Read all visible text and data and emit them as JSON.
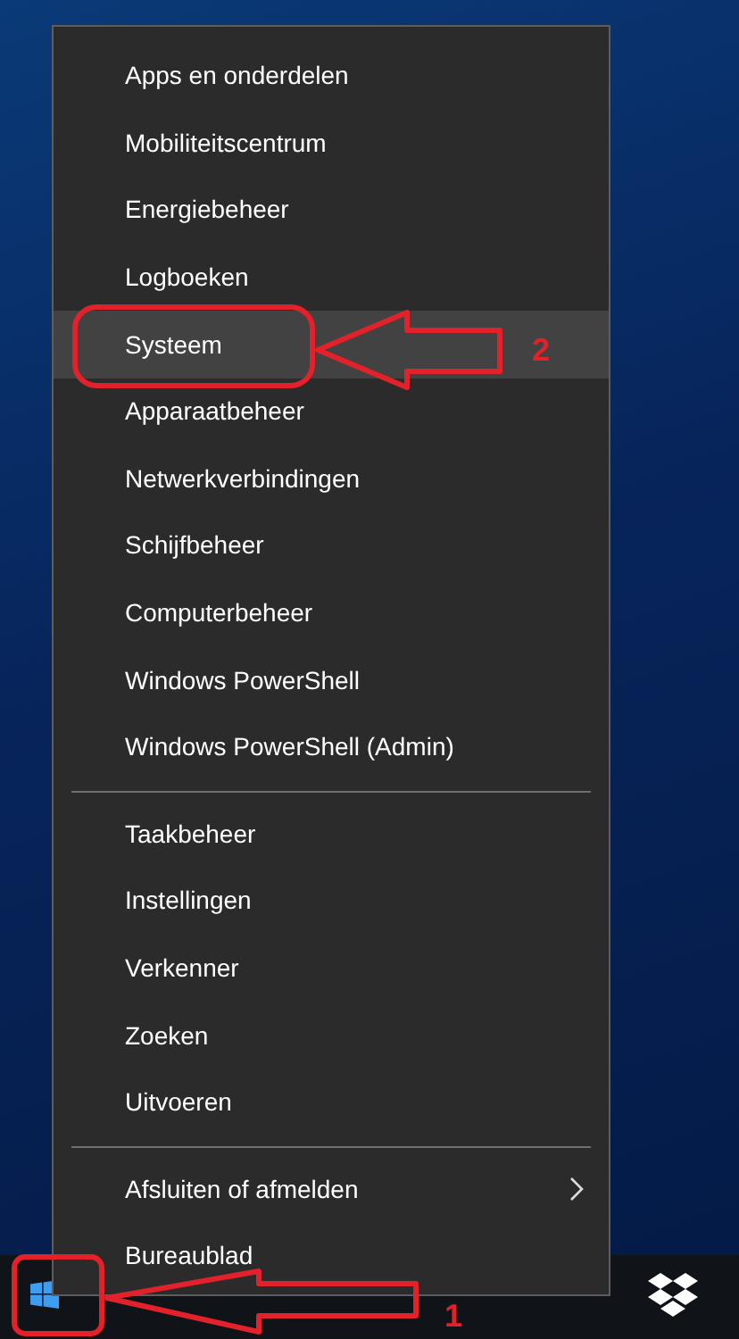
{
  "menu": {
    "groups": [
      {
        "items": [
          {
            "label": "Apps en onderdelen",
            "selected": false
          },
          {
            "label": "Mobiliteitscentrum",
            "selected": false
          },
          {
            "label": "Energiebeheer",
            "selected": false
          },
          {
            "label": "Logboeken",
            "selected": false
          },
          {
            "label": "Systeem",
            "selected": true
          },
          {
            "label": "Apparaatbeheer",
            "selected": false
          },
          {
            "label": "Netwerkverbindingen",
            "selected": false
          },
          {
            "label": "Schijfbeheer",
            "selected": false
          },
          {
            "label": "Computerbeheer",
            "selected": false
          },
          {
            "label": "Windows PowerShell",
            "selected": false
          },
          {
            "label": "Windows PowerShell (Admin)",
            "selected": false
          }
        ]
      },
      {
        "items": [
          {
            "label": "Taakbeheer",
            "selected": false
          },
          {
            "label": "Instellingen",
            "selected": false
          },
          {
            "label": "Verkenner",
            "selected": false
          },
          {
            "label": "Zoeken",
            "selected": false
          },
          {
            "label": "Uitvoeren",
            "selected": false
          }
        ]
      },
      {
        "items": [
          {
            "label": "Afsluiten of afmelden",
            "selected": false,
            "has_submenu": true
          },
          {
            "label": "Bureaublad",
            "selected": false,
            "has_submenu": false
          }
        ]
      }
    ]
  },
  "annotations": [
    {
      "number": "2",
      "kind": "item"
    },
    {
      "number": "1",
      "kind": "start"
    }
  ]
}
